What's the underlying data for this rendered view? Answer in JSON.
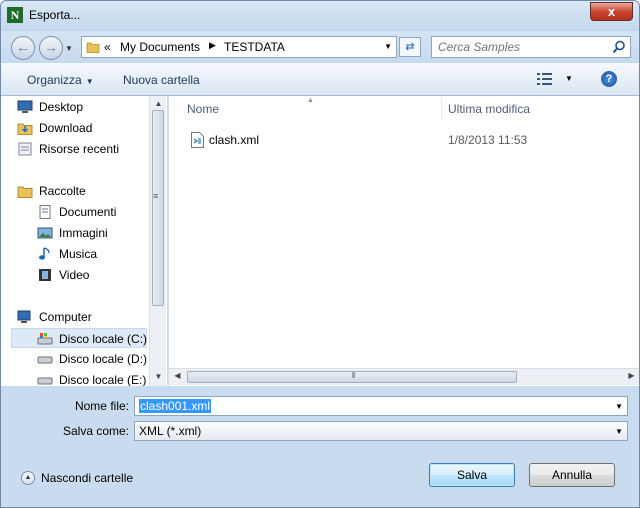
{
  "window": {
    "title": "Esporta...",
    "close_glyph": "x"
  },
  "address": {
    "overflow": "«",
    "crumbs": [
      "My Documents",
      "TESTDATA"
    ],
    "search_placeholder": "Cerca Samples"
  },
  "toolbar": {
    "organize": "Organizza",
    "new_folder": "Nuova cartella",
    "help": "?"
  },
  "nav": {
    "favorites": [
      "Desktop",
      "Download",
      "Risorse recenti"
    ],
    "libraries_header": "Raccolte",
    "libraries": [
      "Documenti",
      "Immagini",
      "Musica",
      "Video"
    ],
    "computer_header": "Computer",
    "drives": [
      "Disco locale (C:)",
      "Disco locale (D:)",
      "Disco locale (E:)"
    ],
    "selected": "Disco locale (C:)"
  },
  "files": {
    "columns": [
      "Nome",
      "Ultima modifica"
    ],
    "rows": [
      {
        "name": "clash.xml",
        "modified": "1/8/2013 11:53"
      }
    ]
  },
  "form": {
    "filename_label": "Nome file:",
    "filename_value": "clash001.xml",
    "type_label": "Salva come:",
    "type_value": "XML (*.xml)"
  },
  "footer": {
    "hide_folders": "Nascondi cartelle",
    "save": "Salva",
    "cancel": "Annulla"
  },
  "colors": {
    "selection": "#3399ff",
    "close_button": "#c8462f",
    "frame": "#c9dcef"
  }
}
